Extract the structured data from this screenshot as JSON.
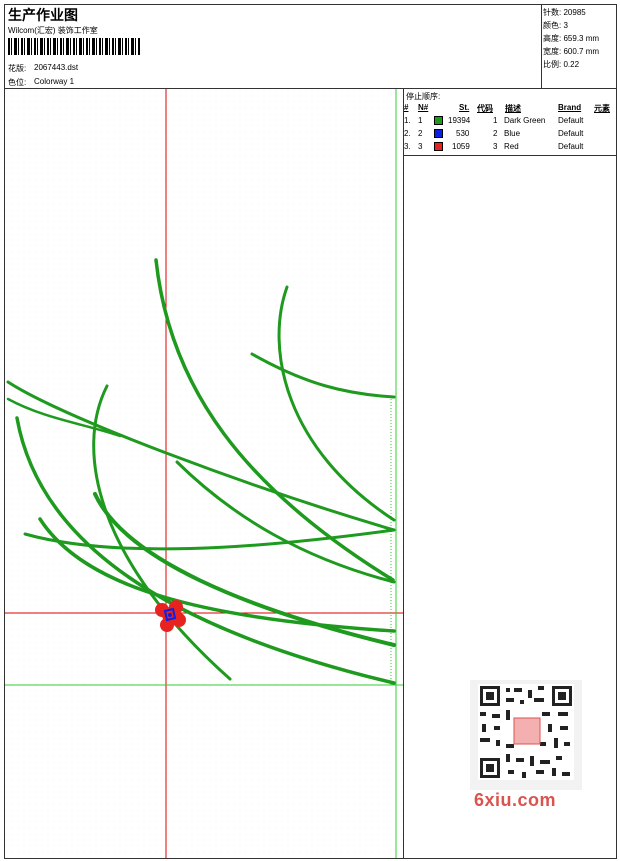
{
  "header": {
    "title": "生产作业图",
    "company": "Wilcom(汇宏) 装饰工作室",
    "design_label": "花版:",
    "design_value": "2067443.dst",
    "colorway_label": "色位:",
    "colorway_value": "Colorway 1"
  },
  "stats": {
    "stitches_label": "针数:",
    "stitches_value": "20985",
    "colors_label": "颜色:",
    "colors_value": "3",
    "height_label": "高度:",
    "height_value": "659.3 mm",
    "width_label": "宽度:",
    "width_value": "600.7 mm",
    "scale_label": "比例:",
    "scale_value": "0.22"
  },
  "stop_sequence": {
    "title": "停止顺序:",
    "headers": {
      "number": "#",
      "needle": "N#",
      "stitches": "St.",
      "code": "代码",
      "description": "描述",
      "brand": "Brand",
      "element": "元素"
    },
    "rows": [
      {
        "number": "1.",
        "needle": "1",
        "color": "#1f9a1f",
        "stitches": "19394",
        "code": "1",
        "description": "Dark Green",
        "brand": "Default"
      },
      {
        "number": "2.",
        "needle": "2",
        "color": "#0b1fe6",
        "stitches": "530",
        "code": "2",
        "description": "Blue",
        "brand": "Default"
      },
      {
        "number": "3.",
        "needle": "3",
        "color": "#e8231f",
        "stitches": "1059",
        "code": "3",
        "description": "Red",
        "brand": "Default"
      }
    ]
  },
  "colors": {
    "stem_green": "#1e9a1e",
    "guide_red": "#e00000",
    "guide_green": "#33cc33",
    "flower_red": "#e8231f",
    "flower_blue": "#0b1fe6"
  },
  "watermark": {
    "text": "6xiu.com"
  }
}
